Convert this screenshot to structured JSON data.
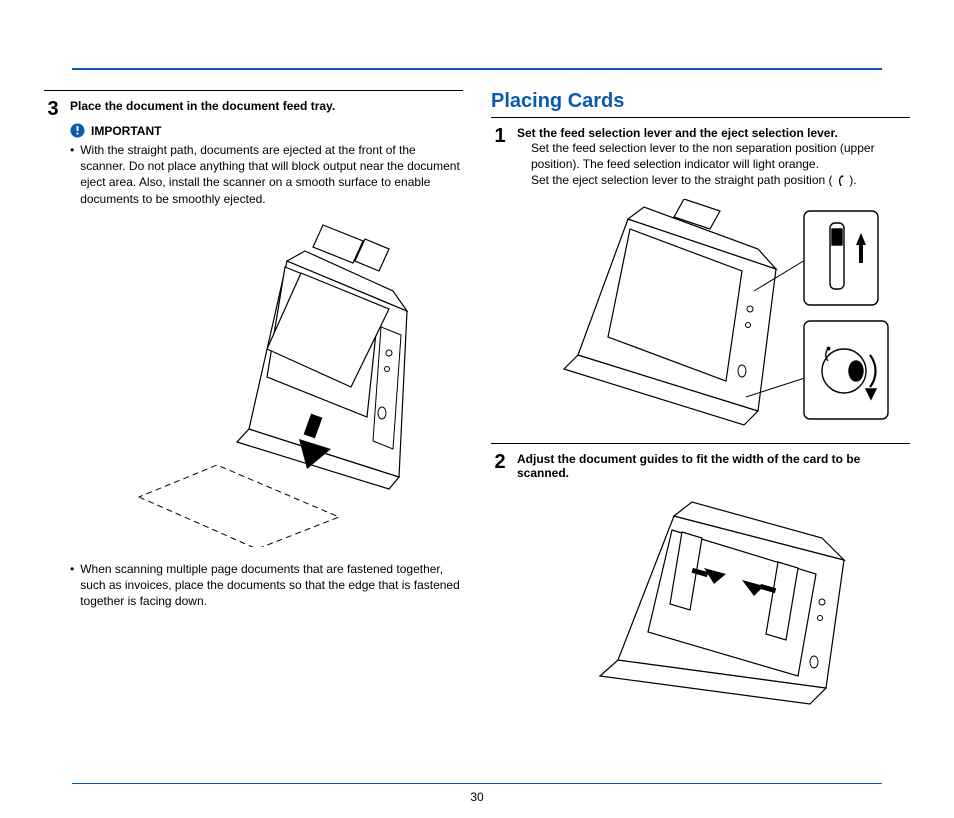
{
  "page_number": "30",
  "left": {
    "step_num": "3",
    "step_title": "Place the document in the document feed tray.",
    "important_label": "IMPORTANT",
    "bullet1": "With the straight path, documents are ejected at the front of the scanner. Do not place anything that will block output near the document eject area. Also, install the scanner on a smooth surface to enable documents to be smoothly ejected.",
    "bullet2": "When scanning multiple page documents that are fastened together, such as invoices, place the documents so that the edge that is fastened together is facing down."
  },
  "right": {
    "heading": "Placing Cards",
    "step1_num": "1",
    "step1_title": "Set the feed selection lever and the eject selection lever.",
    "step1_line1": "Set the feed selection lever to the non separation position (upper position). The feed selection indicator will light orange.",
    "step1_line2a": "Set the eject selection lever to the straight path position (",
    "step1_line2b": ").",
    "step2_num": "2",
    "step2_title": "Adjust the document guides to fit the width of the card to be scanned."
  }
}
